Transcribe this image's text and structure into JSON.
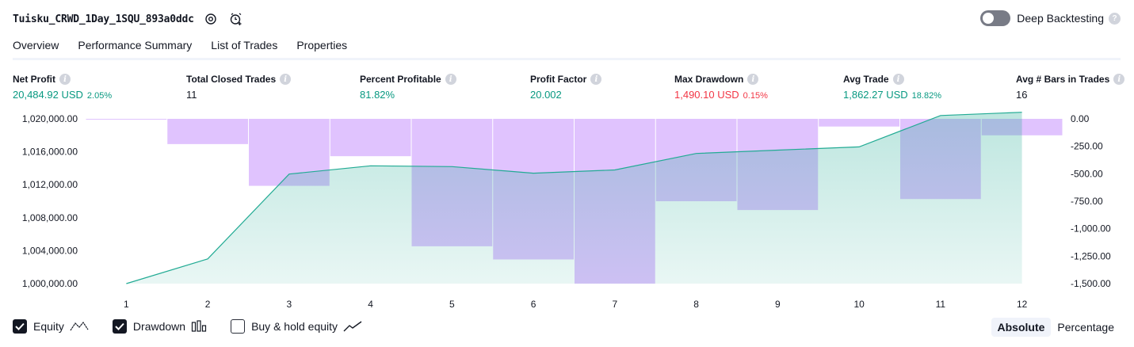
{
  "header": {
    "strategy_name": "Tuisku_CRWD_1Day_1SQU_893a0ddc"
  },
  "deep_backtesting": {
    "label": "Deep Backtesting",
    "enabled": false
  },
  "tabs": [
    {
      "label": "Overview",
      "active": true
    },
    {
      "label": "Performance Summary",
      "active": false
    },
    {
      "label": "List of Trades",
      "active": false
    },
    {
      "label": "Properties",
      "active": false
    }
  ],
  "metrics": [
    {
      "label": "Net Profit",
      "value": "20,484.92 USD",
      "pct": "2.05%",
      "tone": "pos"
    },
    {
      "label": "Total Closed Trades",
      "value": "11",
      "pct": "",
      "tone": "neutral"
    },
    {
      "label": "Percent Profitable",
      "value": "81.82%",
      "pct": "",
      "tone": "pos"
    },
    {
      "label": "Profit Factor",
      "value": "20.002",
      "pct": "",
      "tone": "pos"
    },
    {
      "label": "Max Drawdown",
      "value": "1,490.10 USD",
      "pct": "0.15%",
      "tone": "neg"
    },
    {
      "label": "Avg Trade",
      "value": "1,862.27 USD",
      "pct": "18.82%",
      "tone": "pos"
    },
    {
      "label": "Avg # Bars in Trades",
      "value": "16",
      "pct": "",
      "tone": "neutral"
    }
  ],
  "colors": {
    "positive": "#089981",
    "negative": "#f23645",
    "equity_line": "#22ab94",
    "drawdown_fill": "#d8b4fe"
  },
  "chart_data": {
    "type": "area",
    "x": [
      1,
      2,
      3,
      4,
      5,
      6,
      7,
      8,
      9,
      10,
      11,
      12
    ],
    "x_ticks": [
      "1",
      "2",
      "3",
      "4",
      "5",
      "6",
      "7",
      "8",
      "9",
      "10",
      "11",
      "12"
    ],
    "left_axis": {
      "ticks": [
        "1,000,000.00",
        "1,004,000.00",
        "1,008,000.00",
        "1,012,000.00",
        "1,016,000.00",
        "1,020,000.00"
      ],
      "tick_values": [
        1000000,
        1004000,
        1008000,
        1012000,
        1016000,
        1020000
      ],
      "ylim": [
        1000000,
        1020000
      ]
    },
    "right_axis": {
      "ticks": [
        "0.00",
        "-250.00",
        "-500.00",
        "-750.00",
        "-1,000.00",
        "-1,250.00",
        "-1,500.00"
      ],
      "tick_values": [
        0,
        -250,
        -500,
        -750,
        -1000,
        -1250,
        -1500
      ],
      "ylim": [
        -1500,
        0
      ]
    },
    "series": [
      {
        "name": "Equity",
        "type": "area",
        "axis": "left",
        "values": [
          1000000,
          1003000,
          1013300,
          1014300,
          1014200,
          1013400,
          1013800,
          1015800,
          1016200,
          1016600,
          1020400,
          1020800
        ]
      },
      {
        "name": "Drawdown",
        "type": "bar",
        "axis": "right",
        "values": [
          0,
          -230,
          -610,
          -340,
          -1160,
          -1280,
          -1500,
          -750,
          -830,
          -70,
          -730,
          -150
        ]
      }
    ],
    "grid": false
  },
  "legend": [
    {
      "label": "Equity",
      "checked": true,
      "icon": "equity-line-icon"
    },
    {
      "label": "Drawdown",
      "checked": true,
      "icon": "drawdown-bars-icon"
    },
    {
      "label": "Buy & hold equity",
      "checked": false,
      "icon": "buy-hold-line-icon"
    }
  ],
  "mode": {
    "absolute": "Absolute",
    "percentage": "Percentage",
    "selected": "Absolute"
  }
}
